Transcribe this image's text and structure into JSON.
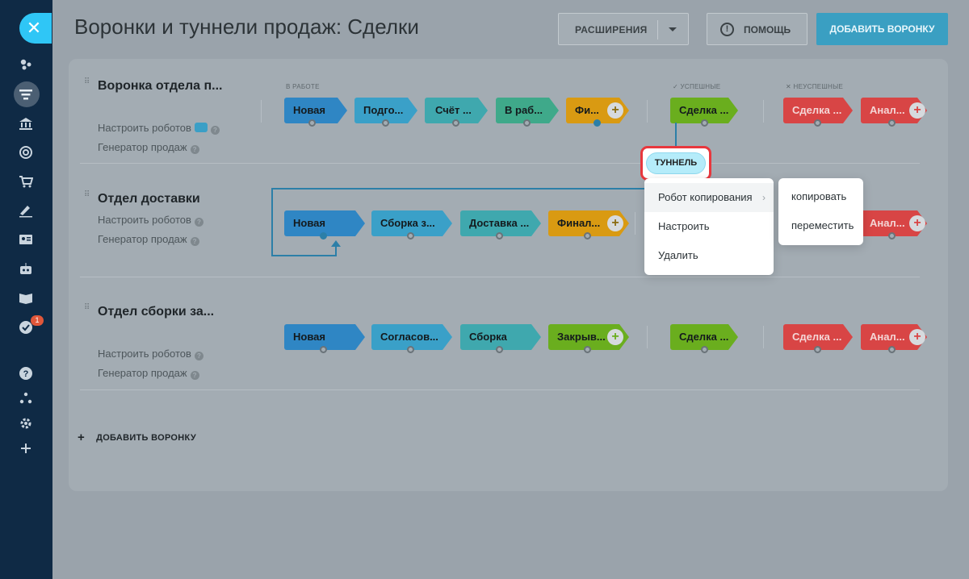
{
  "page": {
    "title": "Воронки и туннели продаж: Сделки",
    "extensions_label": "РАСШИРЕНИЯ",
    "help_label": "ПОМОЩЬ",
    "add_funnel_label": "ДОБАВИТЬ ВОРОНКУ",
    "add_funnel_bottom_label": "ДОБАВИТЬ ВОРОНКУ"
  },
  "columns": {
    "in_progress": "В РАБОТЕ",
    "success": "УСПЕШНЫЕ",
    "fail": "НЕУСПЕШНЫЕ"
  },
  "links": {
    "robots": "Настроить роботов",
    "generator": "Генератор продаж"
  },
  "funnels": [
    {
      "name": "Воронка отдела п...",
      "stages": [
        "Новая",
        "Подго...",
        "Счёт ...",
        "В раб...",
        "Фи..."
      ],
      "success": "Сделка ...",
      "fail": [
        "Сделка ...",
        "Анал..."
      ]
    },
    {
      "name": "Отдел доставки",
      "stages": [
        "Новая",
        "Сборка з...",
        "Доставка ...",
        "Финал..."
      ],
      "fail": [
        "Анал..."
      ]
    },
    {
      "name": "Отдел сборки за...",
      "stages": [
        "Новая",
        "Согласов...",
        "Сборка",
        "Закрыв..."
      ],
      "success": "Сделка ...",
      "fail": [
        "Сделка ...",
        "Анал..."
      ]
    }
  ],
  "tunnel": {
    "label": "ТУННЕЛЬ"
  },
  "context_menu": {
    "items": [
      "Робот копирования",
      "Настроить",
      "Удалить"
    ],
    "submenu": [
      "копировать",
      "переместить"
    ]
  },
  "sidebar": {
    "badge": "1"
  },
  "colors": {
    "sidebar_bg": "#0f2a45",
    "accent": "#2fc6f6",
    "stage_blue": "#2f86c4",
    "stage_cyan": "#3aa0c8",
    "stage_teal": "#3fa8ae",
    "stage_green": "#3fa98a",
    "stage_orange": "#d99a12",
    "success_green": "#6aae1e",
    "fail_red": "#d84545",
    "highlight_red": "#e8373d"
  }
}
